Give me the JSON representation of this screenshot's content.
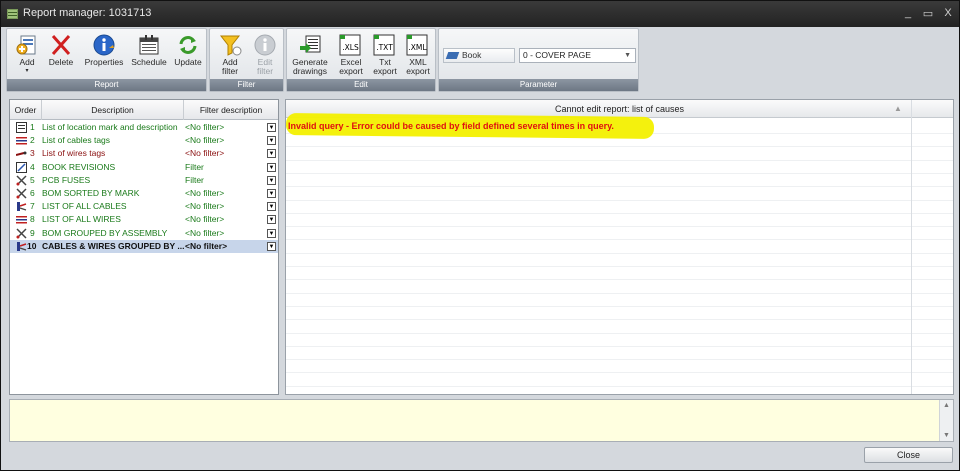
{
  "window": {
    "title": "Report manager: 1031713",
    "minimize": "_",
    "maximize": "▭",
    "close": "X"
  },
  "ribbon": {
    "report": {
      "label": "Report",
      "add": "Add",
      "delete": "Delete",
      "properties": "Properties",
      "schedule": "Schedule",
      "update": "Update"
    },
    "filter": {
      "label": "Filter",
      "add_filter_1": "Add",
      "add_filter_2": "filter",
      "edit_filter_1": "Edit",
      "edit_filter_2": "filter"
    },
    "edit": {
      "label": "Edit",
      "generate_1": "Generate",
      "generate_2": "drawings",
      "excel_1": "Excel",
      "excel_2": "export",
      "txt_1": "Txt",
      "txt_2": "export",
      "xml_1": "XML",
      "xml_2": "export",
      "xls_tag": ".XLS",
      "txt_tag": ".TXT",
      "xml_tag": ".XML"
    },
    "parameter": {
      "label": "Parameter",
      "book_label": "Book",
      "selected": "0 - COVER PAGE"
    }
  },
  "table": {
    "headers": {
      "order": "Order",
      "description": "Description",
      "filter": "Filter description"
    },
    "rows": [
      {
        "num": "1",
        "desc": "List of location mark and description",
        "filter": "<No filter>",
        "icon": "list-location-icon",
        "color": "#1a7a1a"
      },
      {
        "num": "2",
        "desc": "List of cables tags",
        "filter": "<No filter>",
        "icon": "cables-list-icon",
        "color": "#1a7a1a"
      },
      {
        "num": "3",
        "desc": "List of wires tags",
        "filter": "<No filter>",
        "icon": "wire-icon",
        "color": "#8a1010"
      },
      {
        "num": "4",
        "desc": "BOOK REVISIONS",
        "filter": "Filter",
        "icon": "revision-icon",
        "color": "#1a7a1a"
      },
      {
        "num": "5",
        "desc": "PCB FUSES",
        "filter": "Filter",
        "icon": "tools-icon",
        "color": "#1a7a1a"
      },
      {
        "num": "6",
        "desc": "BOM SORTED BY MARK",
        "filter": "<No filter>",
        "icon": "tools-icon",
        "color": "#1a7a1a"
      },
      {
        "num": "7",
        "desc": "LIST OF ALL CABLES",
        "filter": "<No filter>",
        "icon": "cable-group-icon",
        "color": "#1a7a1a"
      },
      {
        "num": "8",
        "desc": "LIST OF ALL WIRES",
        "filter": "<No filter>",
        "icon": "cables-list-icon",
        "color": "#1a7a1a"
      },
      {
        "num": "9",
        "desc": "BOM GROUPED BY ASSEMBLY",
        "filter": "<No filter>",
        "icon": "tools-icon",
        "color": "#1a7a1a"
      },
      {
        "num": "10",
        "desc": "CABLES & WIRES GROUPED BY ...",
        "filter": "<No filter>",
        "icon": "cable-group-icon",
        "color": "#111111"
      }
    ]
  },
  "right": {
    "header": "Cannot edit report: list of causes",
    "error": "Invalid query - Error could be caused by field defined several times in query."
  },
  "footer": {
    "close": "Close"
  },
  "colors": {
    "error": "#e01010",
    "highlight": "#f3f000",
    "message_bg": "#ffffe0"
  }
}
